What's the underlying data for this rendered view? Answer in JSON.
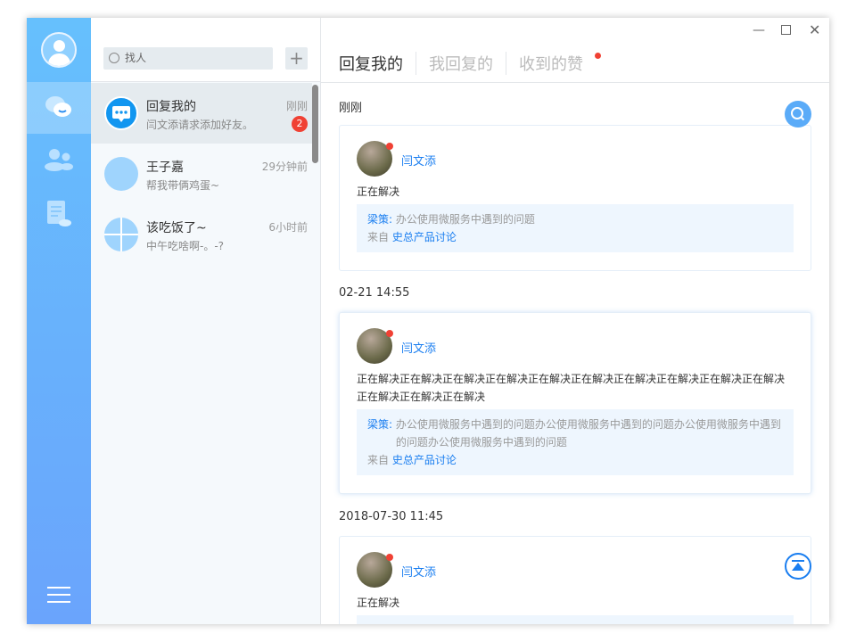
{
  "sidebar": {
    "nav": [
      "messages",
      "contacts",
      "documents"
    ]
  },
  "list": {
    "search_placeholder": "找人",
    "add": "+",
    "items": [
      {
        "name": "回复我的",
        "preview": "闫文添请求添加好友。",
        "time": "刚刚",
        "badge": "2"
      },
      {
        "name": "王子嘉",
        "preview": "帮我带俩鸡蛋~",
        "time": "29分钟前"
      },
      {
        "name": "该吃饭了~",
        "preview": "中午吃啥啊-。-?",
        "time": "6小时前"
      }
    ]
  },
  "main": {
    "tabs": [
      "回复我的",
      "我回复的",
      "收到的赞"
    ],
    "groups": [
      {
        "time": "刚刚",
        "user": "闫文添",
        "text": "正在解决",
        "quote_author": "梁策",
        "quote_sep": ":",
        "quote": "办公使用微服务中遇到的问题",
        "from_label": "来自",
        "from": "史总产品讨论"
      },
      {
        "time": "02-21 14:55",
        "user": "闫文添",
        "text": "正在解决正在解决正在解决正在解决正在解决正在解决正在解决正在解决正在解决正在解决正在解决正在解决正在解决",
        "quote_author": "梁策",
        "quote_sep": ":",
        "quote": "办公使用微服务中遇到的问题办公使用微服务中遇到的问题办公使用微服务中遇到的问题办公使用微服务中遇到的问题",
        "from_label": "来自",
        "from": "史总产品讨论"
      },
      {
        "time": "2018-07-30 11:45",
        "user": "闫文添",
        "text": "正在解决"
      }
    ]
  },
  "colors": {
    "accent": "#1a7ef0",
    "badge": "#f04134",
    "sidebar": "#66c0fd"
  }
}
